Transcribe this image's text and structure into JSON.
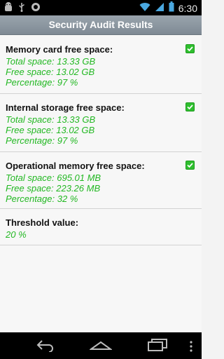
{
  "status_bar": {
    "time": "6:30",
    "icons": [
      "android-debug-icon",
      "usb-icon",
      "sync-icon",
      "wifi-icon",
      "signal-icon",
      "battery-icon"
    ]
  },
  "header": {
    "title": "Security Audit Results"
  },
  "sections": [
    {
      "title": "Memory card free space:",
      "lines": [
        "Total space: 13.33 GB",
        "Free space: 13.02 GB",
        "Percentage: 97 %"
      ],
      "checked": true
    },
    {
      "title": "Internal storage free space:",
      "lines": [
        "Total space: 13.33 GB",
        "Free space: 13.02 GB",
        "Percentage: 97 %"
      ],
      "checked": true
    },
    {
      "title": "Operational memory free space:",
      "lines": [
        "Total space: 695.01 MB",
        "Free space: 223.26 MB",
        "Percentage: 32 %"
      ],
      "checked": true
    },
    {
      "title": "Threshold value:",
      "lines": [
        "20 %"
      ],
      "checked": false
    }
  ],
  "colors": {
    "value_text": "#23b823",
    "header_bg": "#8b959e",
    "check": "#2fbf2f"
  },
  "nav": {
    "icons": [
      "back-icon",
      "home-icon",
      "recent-apps-icon",
      "overflow-menu-icon"
    ]
  }
}
